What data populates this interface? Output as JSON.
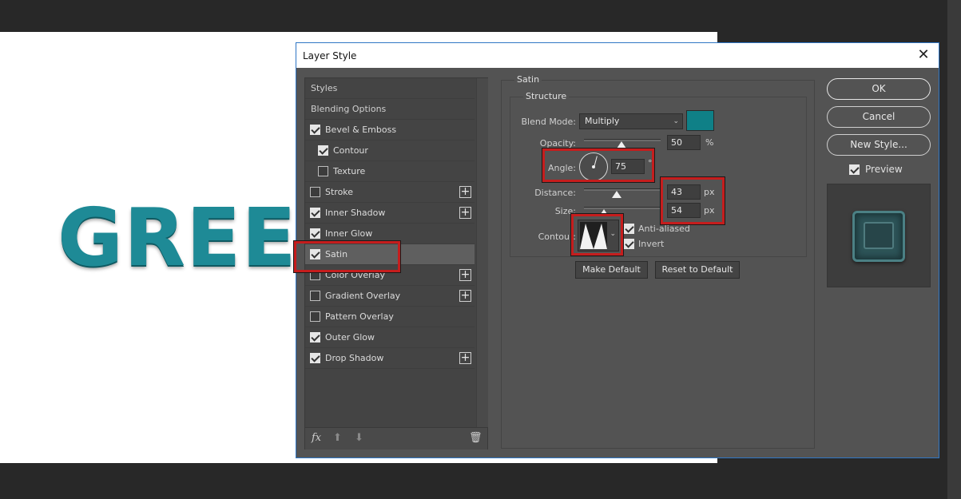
{
  "canvas": {
    "text": "GREEN",
    "text_color": "#1e8a96"
  },
  "dialog": {
    "title": "Layer Style",
    "styles_list": {
      "header": "Styles",
      "blending_options": "Blending Options",
      "items": [
        {
          "label": "Bevel & Emboss",
          "checked": true,
          "plus": false
        },
        {
          "label": "Contour",
          "checked": true,
          "plus": false,
          "indent": true
        },
        {
          "label": "Texture",
          "checked": false,
          "plus": false,
          "indent": true
        },
        {
          "label": "Stroke",
          "checked": false,
          "plus": true
        },
        {
          "label": "Inner Shadow",
          "checked": true,
          "plus": true
        },
        {
          "label": "Inner Glow",
          "checked": true,
          "plus": false
        },
        {
          "label": "Satin",
          "checked": true,
          "plus": false,
          "selected": true
        },
        {
          "label": "Color Overlay",
          "checked": false,
          "plus": true
        },
        {
          "label": "Gradient Overlay",
          "checked": false,
          "plus": true
        },
        {
          "label": "Pattern Overlay",
          "checked": false,
          "plus": false
        },
        {
          "label": "Outer Glow",
          "checked": true,
          "plus": false
        },
        {
          "label": "Drop Shadow",
          "checked": true,
          "plus": true
        }
      ],
      "footer": {
        "fx": "fx"
      }
    },
    "satin": {
      "section_title": "Satin",
      "structure_title": "Structure",
      "blend_mode_label": "Blend Mode:",
      "blend_mode_value": "Multiply",
      "color": "#0f8087",
      "opacity_label": "Opacity:",
      "opacity_value": "50",
      "opacity_unit": "%",
      "angle_label": "Angle:",
      "angle_value": "75",
      "angle_unit": "°",
      "distance_label": "Distance:",
      "distance_value": "43",
      "distance_unit": "px",
      "size_label": "Size:",
      "size_value": "54",
      "size_unit": "px",
      "contour_label": "Contour:",
      "anti_aliased_label": "Anti-aliased",
      "anti_aliased_checked": true,
      "invert_label": "Invert",
      "invert_checked": true,
      "make_default": "Make Default",
      "reset_default": "Reset to Default"
    },
    "buttons": {
      "ok": "OK",
      "cancel": "Cancel",
      "new_style": "New Style..."
    },
    "preview": {
      "label": "Preview",
      "checked": true
    }
  }
}
